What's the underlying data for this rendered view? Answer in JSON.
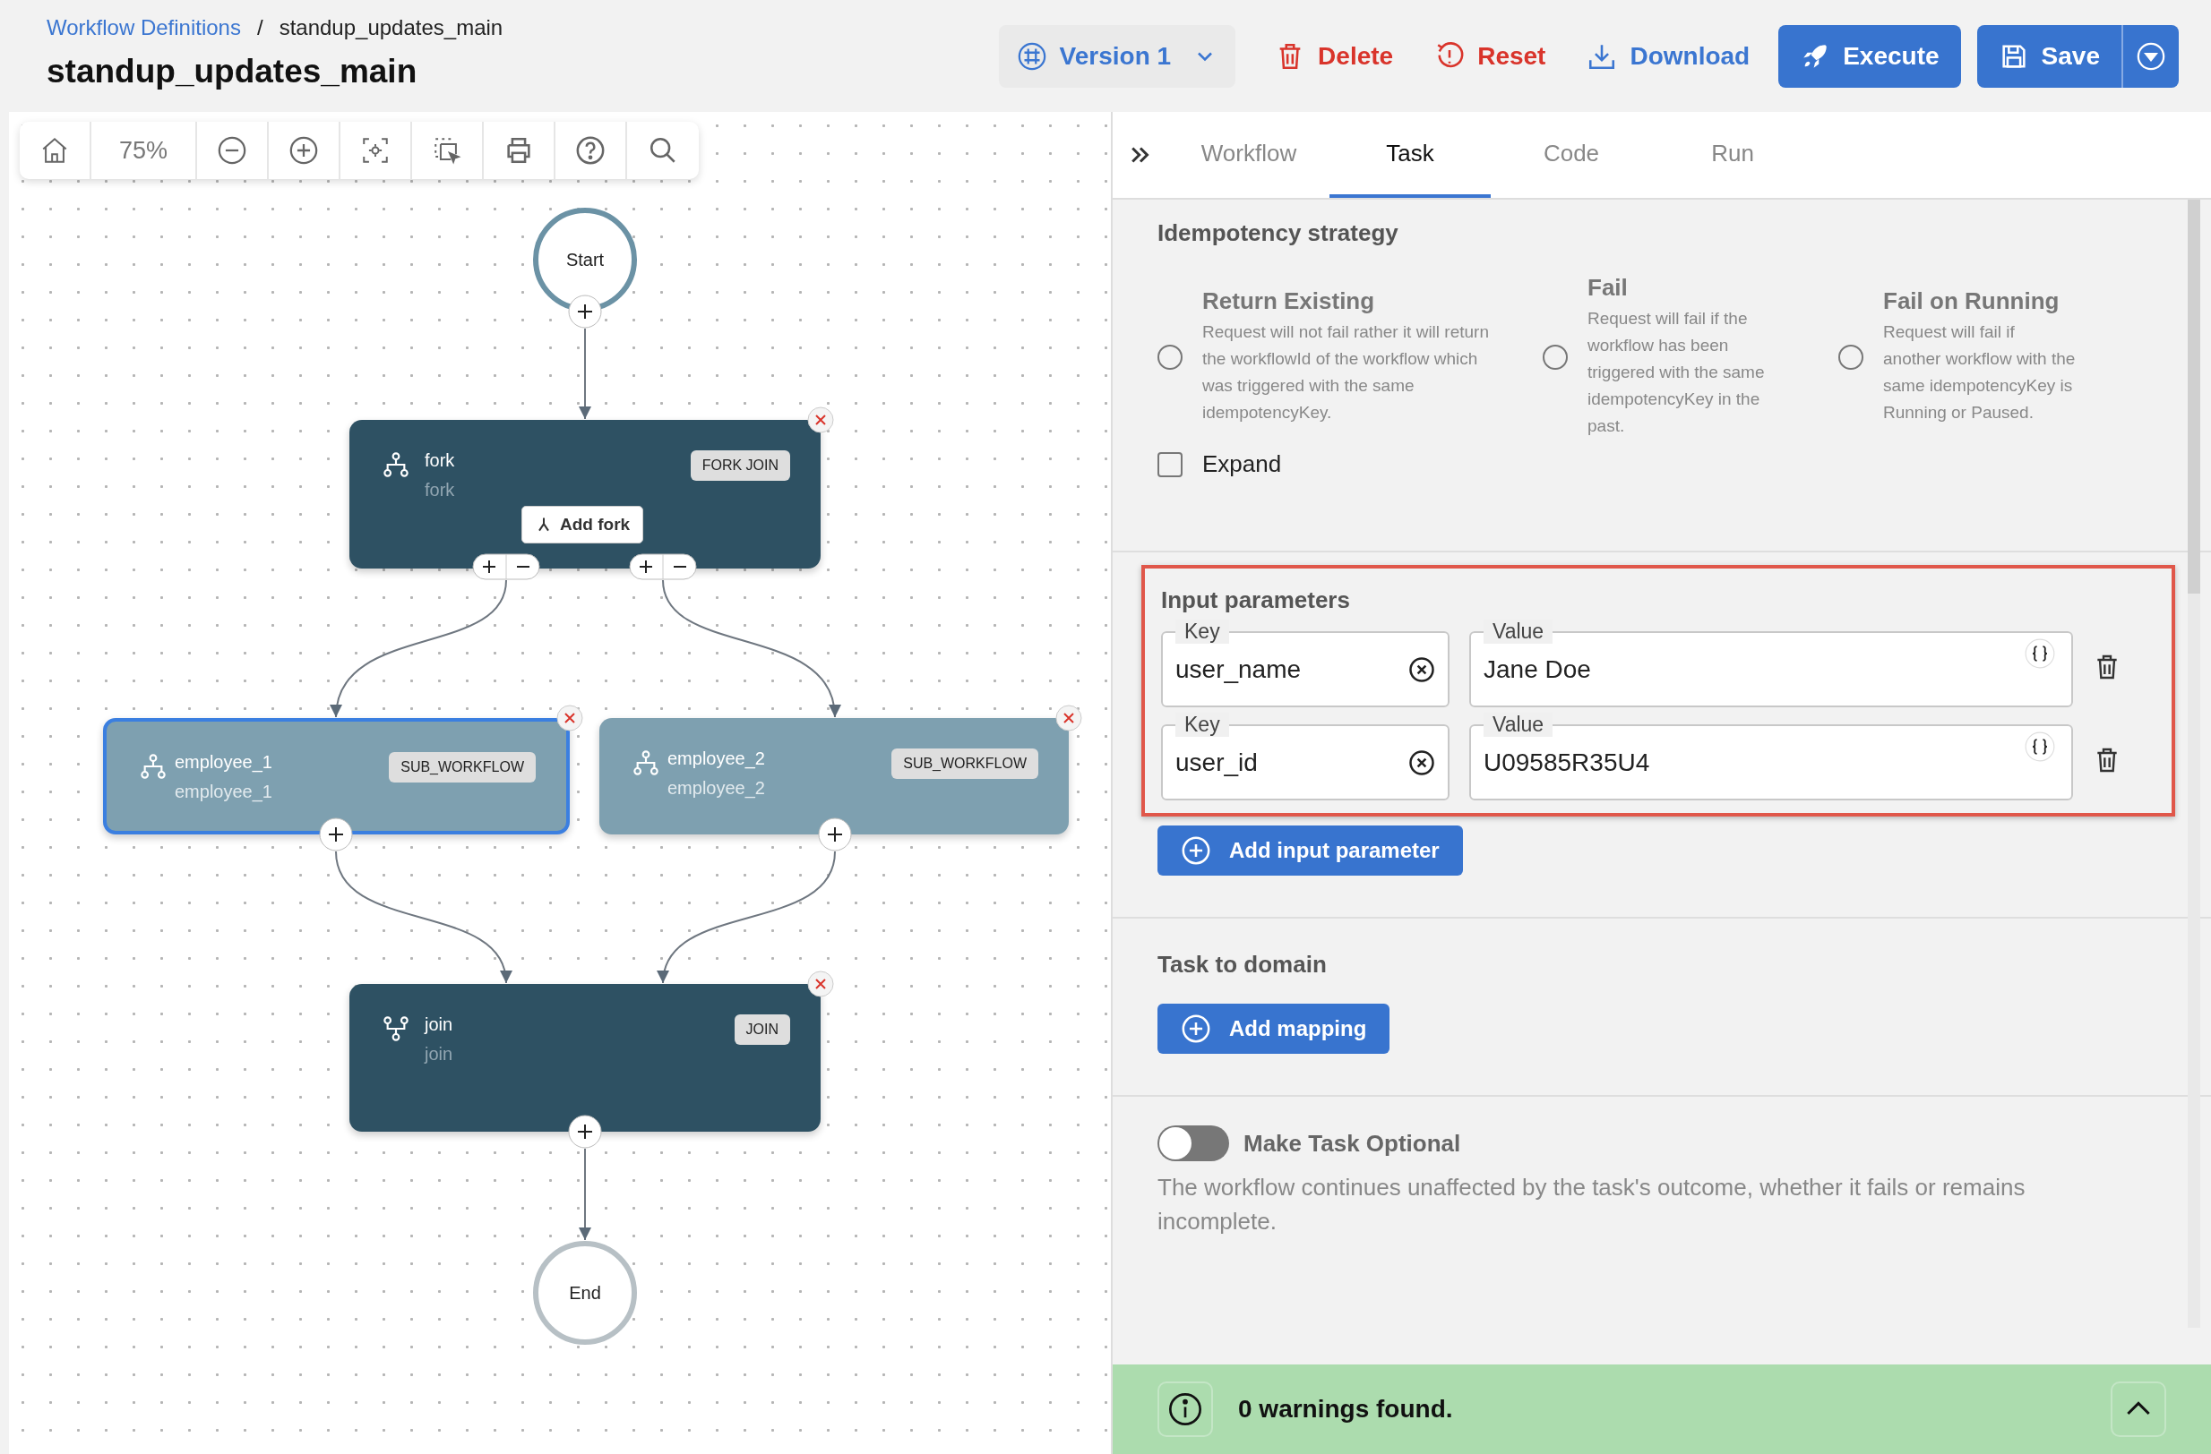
{
  "breadcrumb": {
    "link": "Workflow Definitions",
    "separator": "/",
    "current": "standup_updates_main"
  },
  "title": "standup_updates_main",
  "actions": [
    {
      "kind": "version",
      "label": "Version 1"
    },
    {
      "kind": "delete",
      "label": "Delete"
    },
    {
      "kind": "reset",
      "label": "Reset"
    },
    {
      "kind": "download",
      "label": "Download"
    },
    {
      "kind": "execute",
      "label": "Execute"
    },
    {
      "kind": "save",
      "label": "Save"
    }
  ],
  "toolbar": {
    "zoom": "75%"
  },
  "canvas": {
    "start": "Start",
    "end": "End",
    "nodes": [
      {
        "kind": "fork_join",
        "name": "fork",
        "ref": "fork",
        "type": "FORK JOIN",
        "selected": false,
        "button": "Add fork"
      },
      {
        "kind": "sub_workflow",
        "name": "employee_1",
        "ref": "employee_1",
        "type": "SUB_WORKFLOW",
        "selected": true
      },
      {
        "kind": "sub_workflow",
        "name": "employee_2",
        "ref": "employee_2",
        "type": "SUB_WORKFLOW",
        "selected": false
      },
      {
        "kind": "join",
        "name": "join",
        "ref": "join",
        "type": "JOIN",
        "selected": false
      }
    ]
  },
  "panel_tabs": [
    {
      "label": "Workflow",
      "selected": false
    },
    {
      "label": "Task",
      "selected": true
    },
    {
      "label": "Code",
      "selected": false
    },
    {
      "label": "Run",
      "selected": false
    }
  ],
  "idempotency": {
    "heading": "Idempotency strategy",
    "options": [
      {
        "title": "Return Existing",
        "description": "Request will not fail rather it will return the workflowId of the workflow which was triggered with the same idempotencyKey.",
        "selected": false
      },
      {
        "title": "Fail",
        "description": "Request will fail if the workflow has been triggered with the same idempotencyKey in the past.",
        "selected": false
      },
      {
        "title": "Fail on Running",
        "description": "Request will fail if another workflow with the same idempotencyKey is Running or Paused.",
        "selected": false
      }
    ],
    "expand": {
      "label": "Expand",
      "checked": false
    }
  },
  "input_parameters": {
    "heading": "Input parameters",
    "highlighted": true,
    "rows": [
      {
        "key_label": "Key",
        "key": "user_name",
        "value_label": "Value",
        "value": "Jane Doe"
      },
      {
        "key_label": "Key",
        "key": "user_id",
        "value_label": "Value",
        "value": "U09585R35U4"
      }
    ],
    "add_button": "Add input parameter"
  },
  "task_to_domain": {
    "heading": "Task to domain",
    "add_button": "Add mapping"
  },
  "optional": {
    "label": "Make Task Optional",
    "on": false,
    "description": "The workflow continues unaffected by the task's outcome, whether it fails or remains incomplete."
  },
  "footer": {
    "message": "0 warnings found."
  }
}
